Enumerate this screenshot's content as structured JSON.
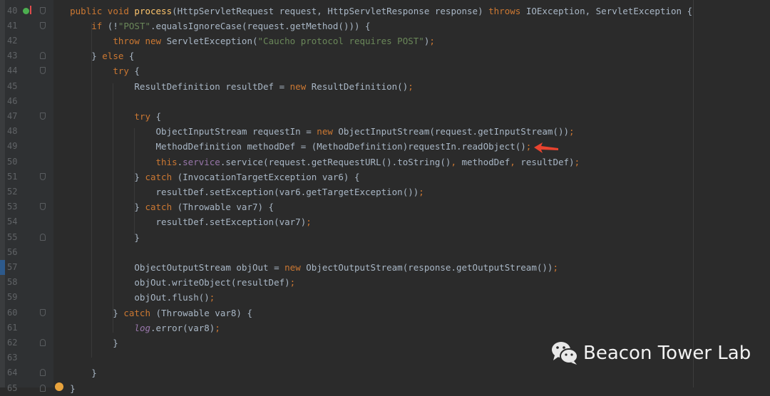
{
  "editor": {
    "colors": {
      "background": "#2b2b2b",
      "keyword": "#cc7832",
      "method": "#ffc66d",
      "string": "#6a8759",
      "field": "#9876aa",
      "text": "#a9b7c6",
      "arrow": "#e8432f"
    },
    "lines": [
      {
        "num": "40",
        "fold": "down",
        "tokens": [
          [
            "    ",
            ""
          ],
          [
            "public void ",
            "kw"
          ],
          [
            "process",
            "fn"
          ],
          [
            "(HttpServletRequest request, HttpServletResponse response) ",
            ""
          ],
          [
            "throws ",
            "kw"
          ],
          [
            "IOException, ServletException {",
            ""
          ]
        ]
      },
      {
        "num": "41",
        "fold": "down",
        "tokens": [
          [
            "        ",
            ""
          ],
          [
            "if ",
            "kw"
          ],
          [
            "(!",
            ""
          ],
          [
            "\"POST\"",
            "str"
          ],
          [
            ".equalsIgnoreCase(request.getMethod())) {",
            ""
          ]
        ]
      },
      {
        "num": "42",
        "fold": "",
        "tokens": [
          [
            "            ",
            ""
          ],
          [
            "throw new ",
            "kw"
          ],
          [
            "ServletException(",
            ""
          ],
          [
            "\"Caucho protocol requires POST\"",
            "str"
          ],
          [
            ")",
            ""
          ],
          [
            ";",
            "kw"
          ]
        ]
      },
      {
        "num": "43",
        "fold": "up",
        "tokens": [
          [
            "        } ",
            ""
          ],
          [
            "else ",
            "kw"
          ],
          [
            "{",
            ""
          ]
        ]
      },
      {
        "num": "44",
        "fold": "down",
        "tokens": [
          [
            "            ",
            ""
          ],
          [
            "try ",
            "kw"
          ],
          [
            "{",
            ""
          ]
        ]
      },
      {
        "num": "45",
        "fold": "",
        "tokens": [
          [
            "                ResultDefinition resultDef = ",
            ""
          ],
          [
            "new ",
            "kw"
          ],
          [
            "ResultDefinition()",
            ""
          ],
          [
            ";",
            "kw"
          ]
        ]
      },
      {
        "num": "46",
        "fold": "",
        "tokens": []
      },
      {
        "num": "47",
        "fold": "down",
        "tokens": [
          [
            "                ",
            ""
          ],
          [
            "try ",
            "kw"
          ],
          [
            "{",
            ""
          ]
        ]
      },
      {
        "num": "48",
        "fold": "",
        "tokens": [
          [
            "                    ObjectInputStream requestIn = ",
            ""
          ],
          [
            "new ",
            "kw"
          ],
          [
            "ObjectInputStream(request.getInputStream())",
            ""
          ],
          [
            ";",
            "kw"
          ]
        ]
      },
      {
        "num": "49",
        "fold": "",
        "tokens": [
          [
            "                    MethodDefinition methodDef = (MethodDefinition)requestIn.readObject()",
            ""
          ],
          [
            ";",
            "kw"
          ]
        ]
      },
      {
        "num": "50",
        "fold": "",
        "tokens": [
          [
            "                    ",
            ""
          ],
          [
            "this",
            "kw"
          ],
          [
            ".",
            ""
          ],
          [
            "service",
            "fld"
          ],
          [
            ".service(request.getRequestURL().toString()",
            ""
          ],
          [
            ",",
            "kw"
          ],
          [
            " methodDef",
            ""
          ],
          [
            ",",
            "kw"
          ],
          [
            " resultDef)",
            ""
          ],
          [
            ";",
            "kw"
          ]
        ]
      },
      {
        "num": "51",
        "fold": "down",
        "tokens": [
          [
            "                } ",
            ""
          ],
          [
            "catch ",
            "kw"
          ],
          [
            "(InvocationTargetException var6) {",
            ""
          ]
        ]
      },
      {
        "num": "52",
        "fold": "",
        "tokens": [
          [
            "                    resultDef.setException(var6.getTargetException())",
            ""
          ],
          [
            ";",
            "kw"
          ]
        ]
      },
      {
        "num": "53",
        "fold": "down",
        "tokens": [
          [
            "                } ",
            ""
          ],
          [
            "catch ",
            "kw"
          ],
          [
            "(Throwable var7) {",
            ""
          ]
        ]
      },
      {
        "num": "54",
        "fold": "",
        "tokens": [
          [
            "                    resultDef.setException(var7)",
            ""
          ],
          [
            ";",
            "kw"
          ]
        ]
      },
      {
        "num": "55",
        "fold": "up",
        "tokens": [
          [
            "                }",
            ""
          ]
        ]
      },
      {
        "num": "56",
        "fold": "",
        "tokens": []
      },
      {
        "num": "57",
        "fold": "",
        "tokens": [
          [
            "                ObjectOutputStream objOut = ",
            ""
          ],
          [
            "new ",
            "kw"
          ],
          [
            "ObjectOutputStream(response.getOutputStream())",
            ""
          ],
          [
            ";",
            "kw"
          ]
        ]
      },
      {
        "num": "58",
        "fold": "",
        "tokens": [
          [
            "                objOut.writeObject(resultDef)",
            ""
          ],
          [
            ";",
            "kw"
          ]
        ]
      },
      {
        "num": "59",
        "fold": "",
        "tokens": [
          [
            "                objOut.flush()",
            ""
          ],
          [
            ";",
            "kw"
          ]
        ]
      },
      {
        "num": "60",
        "fold": "down",
        "tokens": [
          [
            "            } ",
            ""
          ],
          [
            "catch ",
            "kw"
          ],
          [
            "(Throwable var8) {",
            ""
          ]
        ]
      },
      {
        "num": "61",
        "fold": "",
        "tokens": [
          [
            "                ",
            ""
          ],
          [
            "log",
            "fldi"
          ],
          [
            ".error(var8)",
            ""
          ],
          [
            ";",
            "kw"
          ]
        ]
      },
      {
        "num": "62",
        "fold": "up",
        "tokens": [
          [
            "            }",
            ""
          ]
        ]
      },
      {
        "num": "63",
        "fold": "",
        "tokens": []
      },
      {
        "num": "64",
        "fold": "up",
        "tokens": [
          [
            "        }",
            ""
          ]
        ]
      },
      {
        "num": "65",
        "fold": "up",
        "tokens": [
          [
            "    }",
            ""
          ]
        ]
      }
    ]
  },
  "watermark": {
    "text": "Beacon Tower Lab",
    "icon": "wechat-icon"
  }
}
